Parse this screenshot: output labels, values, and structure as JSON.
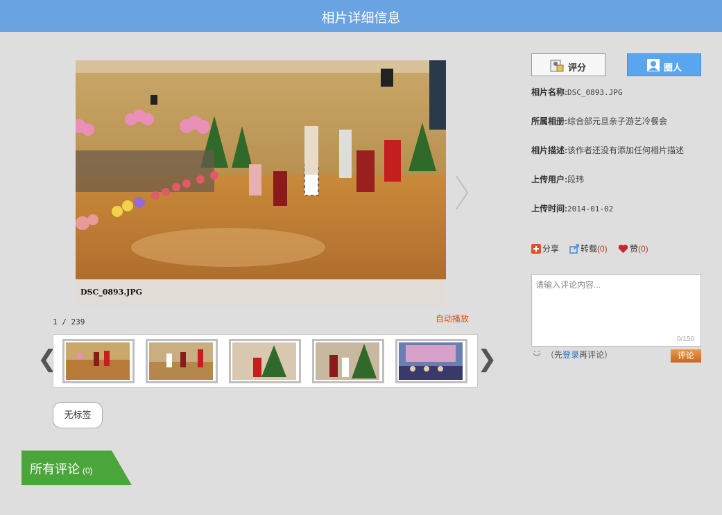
{
  "header": {
    "title": "相片详细信息"
  },
  "photo": {
    "filename_caption": "DSC_0893.JPG"
  },
  "gallery": {
    "counter": "1 / 239",
    "autoplay_label": "自动播放",
    "prev_symbol": "❮",
    "next_symbol": "❯"
  },
  "tags": {
    "empty_label": "无标签"
  },
  "comments_section": {
    "title": "所有评论",
    "count": "(0)"
  },
  "toolbar": {
    "rate_label": "评分",
    "circle_label": "圈人"
  },
  "details": [
    {
      "key": "相片名称:",
      "value": "DSC_0893.JPG"
    },
    {
      "key": "所属相册:",
      "value": "综合部元旦亲子游艺冷餐会"
    },
    {
      "key": "相片描述:",
      "value": "该作者还没有添加任何相片描述"
    },
    {
      "key": "上传用户:",
      "value": "段玮"
    },
    {
      "key": "上传时间:",
      "value": "2014-01-02"
    }
  ],
  "actions": {
    "share_label": "分享",
    "repost_label": "转载",
    "repost_count": "(0)",
    "like_label": "赞",
    "like_count": "(0)"
  },
  "comment_form": {
    "placeholder": "请输入评论内容...",
    "char_count": "0/150",
    "hint_prefix": "（先",
    "hint_link": "登录",
    "hint_suffix": "再评论）",
    "submit_label": "评论"
  },
  "colors": {
    "header_bg": "#6aa3e2",
    "accent_orange": "#d05a14",
    "comments_tab": "#4aa63a",
    "circle_button": "#5aa6ee"
  }
}
